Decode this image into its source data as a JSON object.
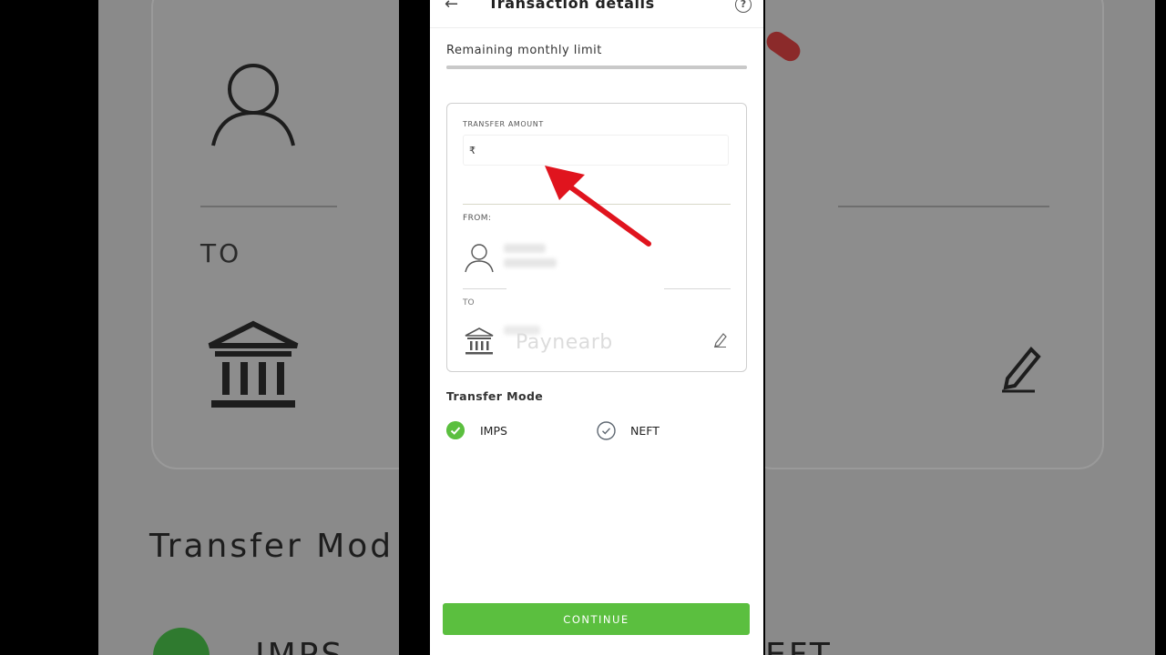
{
  "header": {
    "title": "Transaction details",
    "back_icon": "arrow-left-icon",
    "help_icon": "question-circle-icon",
    "help_glyph": "?"
  },
  "limit": {
    "label": "Remaining monthly limit"
  },
  "transfer": {
    "amount_label": "TRANSFER AMOUNT",
    "currency_symbol": "₹",
    "amount_value": "",
    "from_label": "FROM:",
    "to_label": "TO",
    "watermark": "Paynearb"
  },
  "transfer_mode": {
    "title": "Transfer Mode",
    "options": [
      {
        "label": "IMPS",
        "selected": true
      },
      {
        "label": "NEFT",
        "selected": false
      }
    ]
  },
  "actions": {
    "continue_label": "CONTINUE"
  },
  "background": {
    "to_partial": "TO",
    "transfer_mode_partial": "Transfer Mod",
    "imps_partial": "IMPS",
    "neft_partial": "EFT"
  },
  "colors": {
    "accent": "#5bbf3f",
    "annotation_arrow": "#e0141e"
  }
}
